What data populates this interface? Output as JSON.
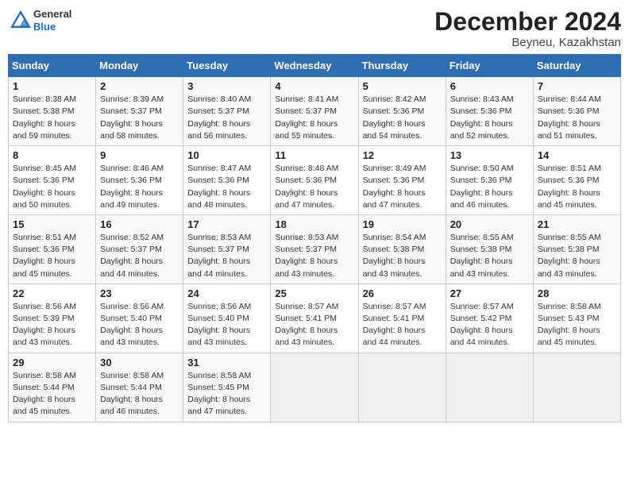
{
  "header": {
    "logo_general": "General",
    "logo_blue": "Blue",
    "title": "December 2024",
    "subtitle": "Beyneu, Kazakhstan"
  },
  "weekdays": [
    "Sunday",
    "Monday",
    "Tuesday",
    "Wednesday",
    "Thursday",
    "Friday",
    "Saturday"
  ],
  "weeks": [
    [
      {
        "day": "1",
        "sunrise": "8:38 AM",
        "sunset": "5:38 PM",
        "daylight": "8 hours and 59 minutes."
      },
      {
        "day": "2",
        "sunrise": "8:39 AM",
        "sunset": "5:37 PM",
        "daylight": "8 hours and 58 minutes."
      },
      {
        "day": "3",
        "sunrise": "8:40 AM",
        "sunset": "5:37 PM",
        "daylight": "8 hours and 56 minutes."
      },
      {
        "day": "4",
        "sunrise": "8:41 AM",
        "sunset": "5:37 PM",
        "daylight": "8 hours and 55 minutes."
      },
      {
        "day": "5",
        "sunrise": "8:42 AM",
        "sunset": "5:36 PM",
        "daylight": "8 hours and 54 minutes."
      },
      {
        "day": "6",
        "sunrise": "8:43 AM",
        "sunset": "5:36 PM",
        "daylight": "8 hours and 52 minutes."
      },
      {
        "day": "7",
        "sunrise": "8:44 AM",
        "sunset": "5:36 PM",
        "daylight": "8 hours and 51 minutes."
      }
    ],
    [
      {
        "day": "8",
        "sunrise": "8:45 AM",
        "sunset": "5:36 PM",
        "daylight": "8 hours and 50 minutes."
      },
      {
        "day": "9",
        "sunrise": "8:46 AM",
        "sunset": "5:36 PM",
        "daylight": "8 hours and 49 minutes."
      },
      {
        "day": "10",
        "sunrise": "8:47 AM",
        "sunset": "5:36 PM",
        "daylight": "8 hours and 48 minutes."
      },
      {
        "day": "11",
        "sunrise": "8:48 AM",
        "sunset": "5:36 PM",
        "daylight": "8 hours and 47 minutes."
      },
      {
        "day": "12",
        "sunrise": "8:49 AM",
        "sunset": "5:36 PM",
        "daylight": "8 hours and 47 minutes."
      },
      {
        "day": "13",
        "sunrise": "8:50 AM",
        "sunset": "5:36 PM",
        "daylight": "8 hours and 46 minutes."
      },
      {
        "day": "14",
        "sunrise": "8:51 AM",
        "sunset": "5:36 PM",
        "daylight": "8 hours and 45 minutes."
      }
    ],
    [
      {
        "day": "15",
        "sunrise": "8:51 AM",
        "sunset": "5:36 PM",
        "daylight": "8 hours and 45 minutes."
      },
      {
        "day": "16",
        "sunrise": "8:52 AM",
        "sunset": "5:37 PM",
        "daylight": "8 hours and 44 minutes."
      },
      {
        "day": "17",
        "sunrise": "8:53 AM",
        "sunset": "5:37 PM",
        "daylight": "8 hours and 44 minutes."
      },
      {
        "day": "18",
        "sunrise": "8:53 AM",
        "sunset": "5:37 PM",
        "daylight": "8 hours and 43 minutes."
      },
      {
        "day": "19",
        "sunrise": "8:54 AM",
        "sunset": "5:38 PM",
        "daylight": "8 hours and 43 minutes."
      },
      {
        "day": "20",
        "sunrise": "8:55 AM",
        "sunset": "5:38 PM",
        "daylight": "8 hours and 43 minutes."
      },
      {
        "day": "21",
        "sunrise": "8:55 AM",
        "sunset": "5:38 PM",
        "daylight": "8 hours and 43 minutes."
      }
    ],
    [
      {
        "day": "22",
        "sunrise": "8:56 AM",
        "sunset": "5:39 PM",
        "daylight": "8 hours and 43 minutes."
      },
      {
        "day": "23",
        "sunrise": "8:56 AM",
        "sunset": "5:40 PM",
        "daylight": "8 hours and 43 minutes."
      },
      {
        "day": "24",
        "sunrise": "8:56 AM",
        "sunset": "5:40 PM",
        "daylight": "8 hours and 43 minutes."
      },
      {
        "day": "25",
        "sunrise": "8:57 AM",
        "sunset": "5:41 PM",
        "daylight": "8 hours and 43 minutes."
      },
      {
        "day": "26",
        "sunrise": "8:57 AM",
        "sunset": "5:41 PM",
        "daylight": "8 hours and 44 minutes."
      },
      {
        "day": "27",
        "sunrise": "8:57 AM",
        "sunset": "5:42 PM",
        "daylight": "8 hours and 44 minutes."
      },
      {
        "day": "28",
        "sunrise": "8:58 AM",
        "sunset": "5:43 PM",
        "daylight": "8 hours and 45 minutes."
      }
    ],
    [
      {
        "day": "29",
        "sunrise": "8:58 AM",
        "sunset": "5:44 PM",
        "daylight": "8 hours and 45 minutes."
      },
      {
        "day": "30",
        "sunrise": "8:58 AM",
        "sunset": "5:44 PM",
        "daylight": "8 hours and 46 minutes."
      },
      {
        "day": "31",
        "sunrise": "8:58 AM",
        "sunset": "5:45 PM",
        "daylight": "8 hours and 47 minutes."
      },
      null,
      null,
      null,
      null
    ]
  ],
  "labels": {
    "sunrise": "Sunrise:",
    "sunset": "Sunset:",
    "daylight": "Daylight:"
  }
}
